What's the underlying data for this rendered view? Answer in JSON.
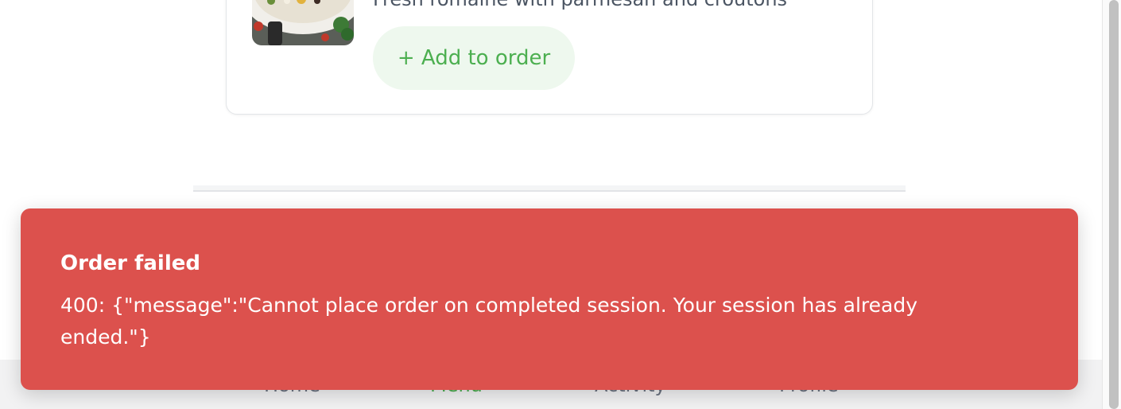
{
  "menu_item": {
    "description": "Fresh romaine with parmesan and croutons",
    "add_button_label": "+ Add to order",
    "image_icon": "salad-bowl-image"
  },
  "bottom_nav": {
    "items": [
      {
        "label": "Home"
      },
      {
        "label": "Menu"
      },
      {
        "label": "Activity"
      },
      {
        "label": "Profile"
      }
    ],
    "active_color": "#4caf50"
  },
  "toast": {
    "title": "Order failed",
    "message": "400: {\"message\":\"Cannot place order on completed session. Your session has already ended.\"}",
    "background_color": "#dc514d"
  }
}
